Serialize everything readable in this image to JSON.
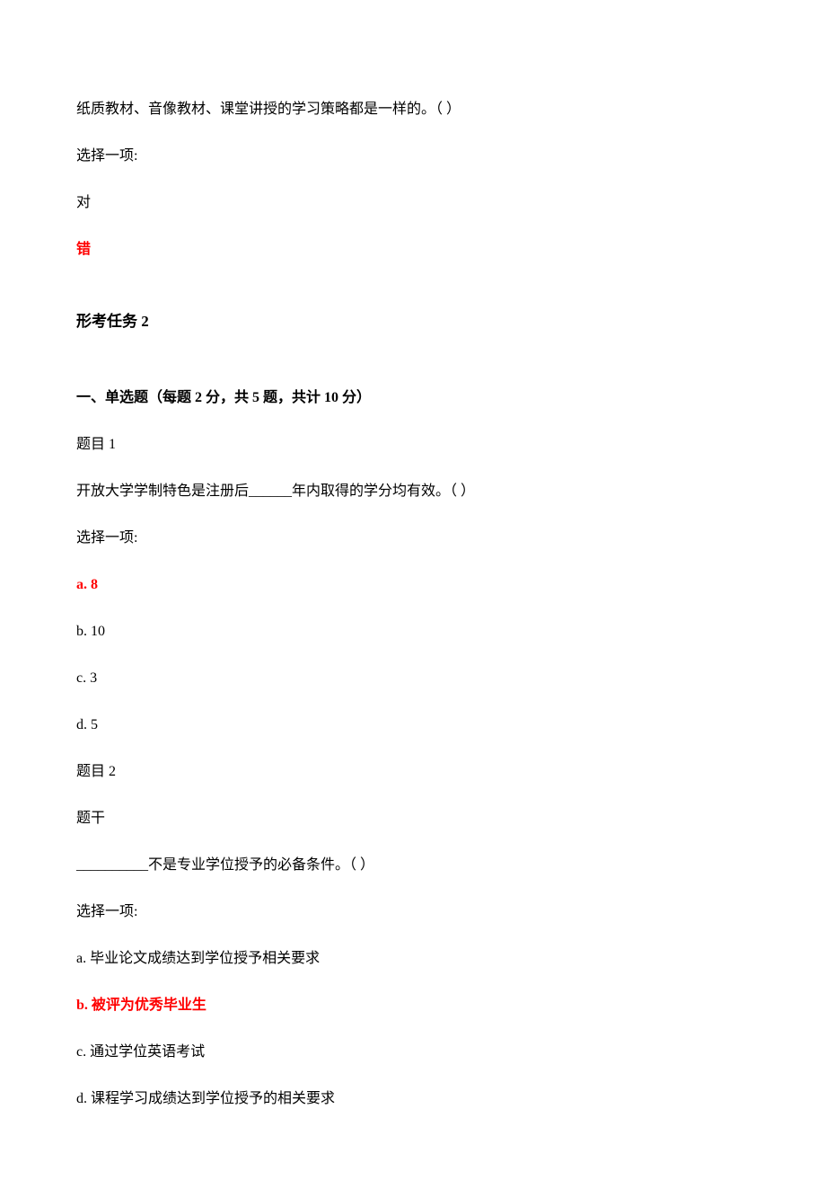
{
  "q_prev": {
    "stem": "纸质教材、音像教材、课堂讲授的学习策略都是一样的。（    ）",
    "prompt": "选择一项:",
    "opt_true": "对",
    "opt_false_answer": "错"
  },
  "task_title": "形考任务 2",
  "section1_heading": "一、单选题（每题 2 分，共 5 题，共计 10 分）",
  "q1": {
    "label": "题目 1",
    "stem": "开放大学学制特色是注册后______年内取得的学分均有效。（    ）",
    "prompt": "选择一项:",
    "a_answer": "a. 8",
    "b": "b. 10",
    "c": "c. 3",
    "d": "d. 5"
  },
  "q2": {
    "label": "题目 2",
    "stem_label": "题干",
    "stem": " __________不是专业学位授予的必备条件。（    ）",
    "prompt": "选择一项:",
    "a": "a. 毕业论文成绩达到学位授予相关要求",
    "b_answer": "b. 被评为优秀毕业生",
    "c": "c. 通过学位英语考试",
    "d": "d. 课程学习成绩达到学位授予的相关要求"
  }
}
